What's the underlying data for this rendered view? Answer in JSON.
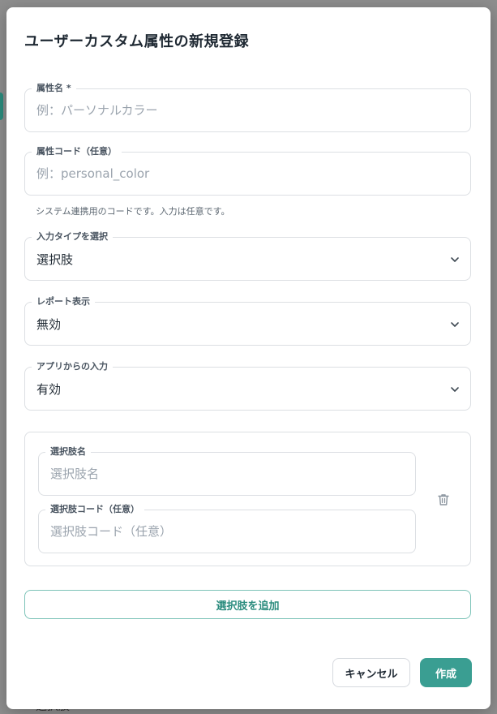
{
  "backdrop": {
    "partial_text": "選択肢"
  },
  "modal": {
    "title": "ユーザーカスタム属性の新規登録"
  },
  "form": {
    "attribute_name": {
      "label": "属性名 *",
      "value": "",
      "placeholder": "例：パーソナルカラー"
    },
    "attribute_code": {
      "label": "属性コード（任意）",
      "value": "",
      "placeholder": "例：personal_color",
      "helper": "システム連携用のコードです。入力は任意です。"
    },
    "input_type": {
      "label": "入力タイプを選択",
      "selected": "選択肢",
      "icon": "chevron-down-icon"
    },
    "report_display": {
      "label": "レポート表示",
      "selected": "無効",
      "icon": "chevron-down-icon"
    },
    "app_input": {
      "label": "アプリからの入力",
      "selected": "有効",
      "icon": "chevron-down-icon"
    }
  },
  "choices": {
    "items": [
      {
        "name_label": "選択肢名",
        "name_placeholder": "選択肢名",
        "code_label": "選択肢コード（任意）",
        "code_placeholder": "選択肢コード（任意）",
        "delete_icon": "trash-icon"
      }
    ],
    "add_label": "選択肢を追加"
  },
  "footer": {
    "cancel_label": "キャンセル",
    "create_label": "作成"
  },
  "colors": {
    "accent": "#3a9e92",
    "accent_text": "#2b8c7e",
    "accent_border": "#7cc3b8",
    "border": "#dcdfe3",
    "overlay": "#8e8e8e"
  }
}
